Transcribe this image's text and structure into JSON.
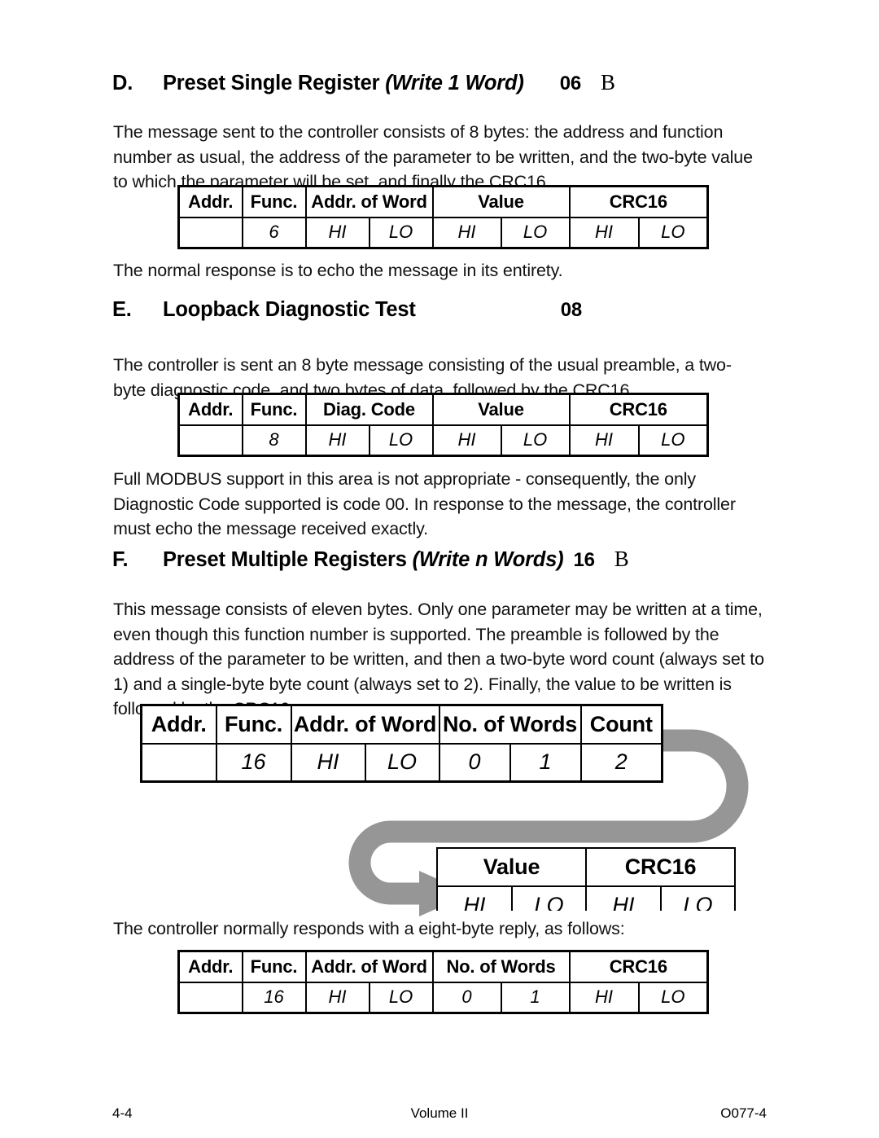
{
  "page": {
    "footer": {
      "left": "4-4",
      "center": "Volume II",
      "right": "O077-4"
    }
  },
  "sections": [
    {
      "letter": "D.",
      "title_plain": "Preset Single Register ",
      "title_italic": "(Write 1 Word)",
      "code": "06",
      "bmark": "B",
      "paragraph": "The message sent to the controller consists of 8 bytes: the address and function number as usual, the address of the parameter to be written, and the two-byte value to which the parameter will be set, and finally the CRC16.",
      "after_paragraph": "The normal response is to echo the message in its entirety."
    },
    {
      "letter": "E.",
      "title_plain": "Loopback Diagnostic Test",
      "title_italic": "",
      "code": "08",
      "bmark": "",
      "paragraph": "The controller is sent an 8 byte message consisting of the usual preamble, a two-byte diagnostic code, and two bytes of data, followed by the CRC16.",
      "after_paragraph": "Full MODBUS support in this area is not appropriate - consequently, the only Diagnostic Code supported is code 00.  In response to the message, the controller must echo the message received exactly."
    },
    {
      "letter": "F.",
      "title_plain": "Preset Multiple Registers ",
      "title_italic": "(Write n Words)",
      "code": "16",
      "bmark": "B",
      "paragraph": "This message consists of eleven bytes.  Only one parameter may be written at a time, even though this function number is supported.  The preamble is followed by the address of the parameter to be written, and then a two-byte word count (always set to 1) and a single-byte byte count (always set to 2).  Finally, the value to be written is followed by the CRC16.",
      "after_paragraph": "The controller normally responds with a eight-byte reply, as follows:"
    }
  ],
  "tables": {
    "preset_single_register": {
      "headers": [
        "Addr.",
        "Func.",
        "Addr. of Word",
        "Value",
        "CRC16"
      ],
      "values": [
        "",
        "6",
        "HI",
        "LO",
        "HI",
        "LO",
        "HI",
        "LO"
      ]
    },
    "loopback_diagnostic": {
      "headers": [
        "Addr.",
        "Func.",
        "Diag. Code",
        "Value",
        "CRC16"
      ],
      "values": [
        "",
        "8",
        "HI",
        "LO",
        "HI",
        "LO",
        "HI",
        "LO"
      ]
    },
    "preset_multiple_request": {
      "headers": [
        "Addr.",
        "Func.",
        "Addr. of Word",
        "No. of Words",
        "Count"
      ],
      "values": [
        "",
        "16",
        "HI",
        "LO",
        "0",
        "1",
        "2"
      ]
    },
    "preset_multiple_continuation": {
      "headers": [
        "Value",
        "CRC16"
      ],
      "values": [
        "HI",
        "LO",
        "HI",
        "LO"
      ]
    },
    "preset_multiple_response": {
      "headers": [
        "Addr.",
        "Func.",
        "Addr. of Word",
        "No. of Words",
        "CRC16"
      ],
      "values": [
        "",
        "16",
        "HI",
        "LO",
        "0",
        "1",
        "HI",
        "LO"
      ]
    }
  },
  "graphics": {
    "continuation_arrow": {
      "name": "u-turn-arrow",
      "color": "#969696"
    }
  }
}
